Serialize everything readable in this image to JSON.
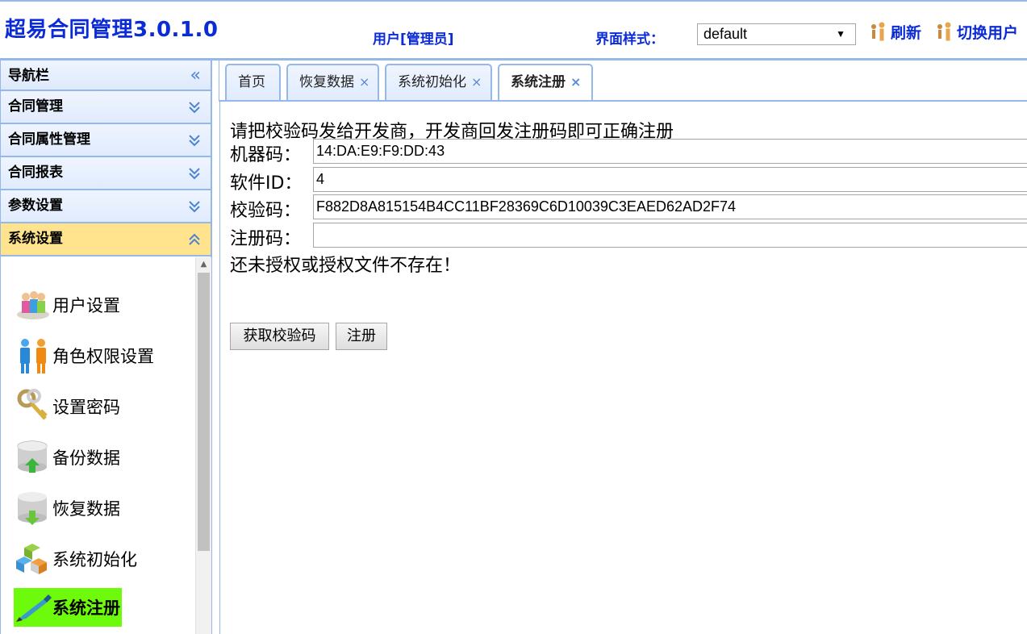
{
  "header": {
    "app_title": "超易合同管理3.0.1.0",
    "user_info": "用户[管理员]",
    "theme_label": "界面样式：",
    "theme_value": "default",
    "refresh_label": "刷新",
    "switch_user_label": "切换用户",
    "accent_color": "#0b2bd6"
  },
  "sidebar": {
    "title": "导航栏",
    "sections": [
      {
        "label": "合同管理"
      },
      {
        "label": "合同属性管理"
      },
      {
        "label": "合同报表"
      },
      {
        "label": "参数设置"
      },
      {
        "label": "系统设置"
      }
    ],
    "items": [
      {
        "label": "用户设置",
        "icon": "users-icon"
      },
      {
        "label": "角色权限设置",
        "icon": "role-users-icon"
      },
      {
        "label": "设置密码",
        "icon": "keys-icon"
      },
      {
        "label": "备份数据",
        "icon": "database-backup-icon"
      },
      {
        "label": "恢复数据",
        "icon": "database-restore-icon"
      },
      {
        "label": "系统初始化",
        "icon": "cubes-icon"
      },
      {
        "label": "系统注册",
        "icon": "register-pen-icon"
      }
    ]
  },
  "tabs": [
    {
      "label": "首页"
    },
    {
      "label": "恢复数据"
    },
    {
      "label": "系统初始化"
    },
    {
      "label": "系统注册"
    }
  ],
  "main": {
    "instruction": "请把校验码发给开发商，开发商回发注册码即可正确注册",
    "machine_code_label": "机器码：",
    "machine_code_value": "14:DA:E9:F9:DD:43",
    "software_id_label": "软件ID：",
    "software_id_value": "4",
    "checksum_label": "校验码：",
    "checksum_value": "F882D8A815154B4CC11BF28369C6D10039C3EAED62AD2F74",
    "reg_code_label": "注册码：",
    "reg_code_value": "",
    "status_text": "还未授权或授权文件不存在！",
    "get_checksum_button": "获取校验码",
    "register_button": "注册"
  }
}
